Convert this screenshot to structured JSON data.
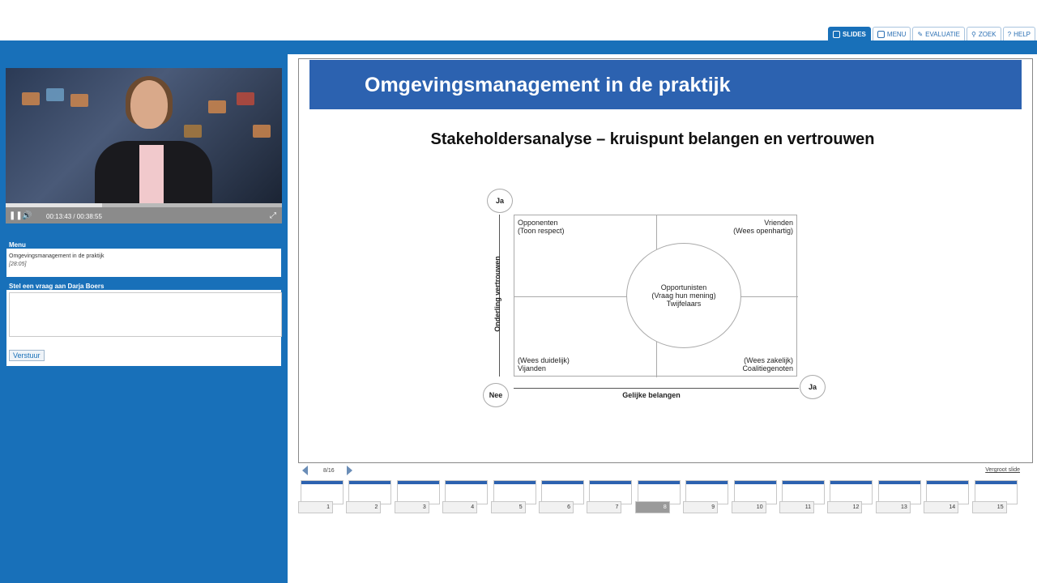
{
  "tabs": [
    {
      "label": "SLIDES",
      "icon": "slides-icon",
      "active": true
    },
    {
      "label": "MENU",
      "icon": "menu-icon",
      "active": false
    },
    {
      "label": "EVALUATIE",
      "icon": "pencil-icon",
      "active": false
    },
    {
      "label": "ZOEK",
      "icon": "search-icon",
      "active": false
    },
    {
      "label": "HELP",
      "icon": "help-icon",
      "active": false
    }
  ],
  "player": {
    "time": "00:13:43 / 00:38:55",
    "progress": 0.35
  },
  "menu": {
    "title": "Menu",
    "item": "Omgevingsmanagement in de praktijk",
    "duration": "[28:05]"
  },
  "question": {
    "title": "Stel een vraag aan Darja Boers",
    "value": "",
    "send_label": "Verstuur"
  },
  "slide": {
    "title": "Omgevingsmanagement in de praktijk",
    "subtitle": "Stakeholdersanalyse – kruispunt belangen en vertrouwen",
    "q1a": "Opponenten",
    "q1b": "(Toon respect)",
    "q2a": "Vrienden",
    "q2b": "(Wees openhartig)",
    "q3a": "(Wees duidelijk)",
    "q3b": "Vijanden",
    "q4a": "(Wees zakelijk)",
    "q4b": "Coalitiegenoten",
    "center1": "Opportunisten",
    "center2": "(Vraag hun mening)",
    "center3": "Twijfelaars",
    "yes_top": "Ja",
    "no": "Nee",
    "yes_right": "Ja",
    "vaxis": "Onderling vertrouwen",
    "haxis": "Gelijke belangen"
  },
  "nav": {
    "counter": "8/16",
    "enlarge": "Vergroot slide"
  },
  "thumbs": [
    "1",
    "2",
    "3",
    "4",
    "5",
    "6",
    "7",
    "8",
    "9",
    "10",
    "11",
    "12",
    "13",
    "14",
    "15"
  ],
  "active_thumb": "8",
  "colors": {
    "brand": "#1870b9",
    "slide_header": "#2c62b0"
  }
}
